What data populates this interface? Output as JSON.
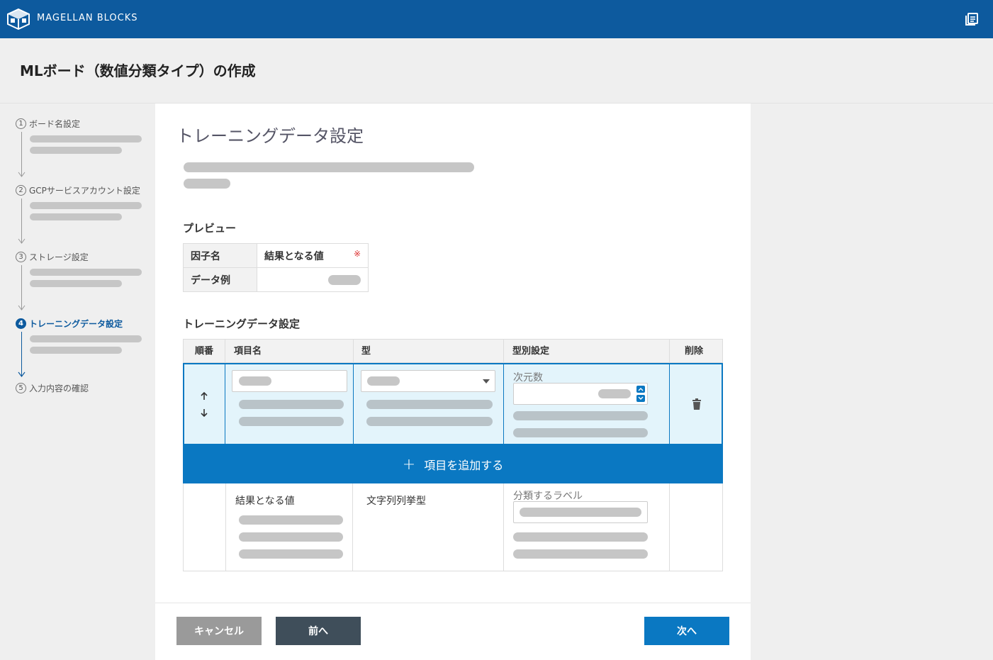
{
  "header": {
    "brand": "MAGELLAN BLOCKS",
    "logo_icon": "cube-logo-icon",
    "docs_icon": "documents-icon"
  },
  "page": {
    "title": "MLボード（数値分類タイプ）の作成"
  },
  "sidebar": {
    "steps": [
      {
        "num": "1",
        "label": "ボード名設定",
        "state": "done"
      },
      {
        "num": "2",
        "label": "GCPサービスアカウント設定",
        "state": "done"
      },
      {
        "num": "3",
        "label": "ストレージ設定",
        "state": "done"
      },
      {
        "num": "4",
        "label": "トレーニングデータ設定",
        "state": "active"
      },
      {
        "num": "5",
        "label": "入力内容の確認",
        "state": "pending"
      }
    ]
  },
  "main": {
    "title": "トレーニングデータ設定",
    "preview": {
      "heading": "プレビュー",
      "row_header_factor": "因子名",
      "result_label": "結果となる値",
      "required_mark": "※",
      "row_header_example": "データ例"
    },
    "training": {
      "heading": "トレーニングデータ設定",
      "columns": [
        "順番",
        "項目名",
        "型",
        "型別設定",
        "削除"
      ],
      "dimension_label": "次元数",
      "add_label": "項目を追加する",
      "result_row": {
        "name": "結果となる値",
        "type": "文字列列挙型",
        "setting_label": "分類するラベル"
      }
    }
  },
  "footer": {
    "cancel": "キャンセル",
    "prev": "前へ",
    "next": "次へ"
  },
  "colors": {
    "header": "#0d5a9e",
    "accent": "#0a78c2",
    "row_highlight": "#e3f4fb",
    "prev_button": "#3f4e5a",
    "cancel_button": "#9a9a9a"
  }
}
